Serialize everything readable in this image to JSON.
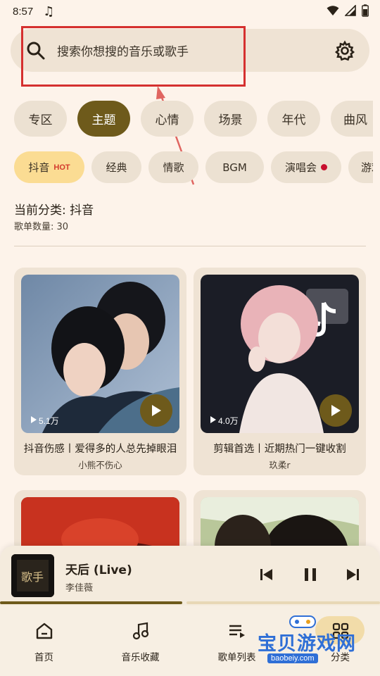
{
  "status_bar": {
    "time": "8:57"
  },
  "search": {
    "placeholder": "搜索你想搜的音乐或歌手"
  },
  "tabs_primary": [
    {
      "label": "专区",
      "active": false
    },
    {
      "label": "主题",
      "active": true
    },
    {
      "label": "心情",
      "active": false
    },
    {
      "label": "场景",
      "active": false
    },
    {
      "label": "年代",
      "active": false
    },
    {
      "label": "曲风",
      "active": false
    }
  ],
  "tabs_secondary": [
    {
      "label": "抖音",
      "badge": "HOT",
      "active": true
    },
    {
      "label": "经典",
      "active": false
    },
    {
      "label": "情歌",
      "active": false
    },
    {
      "label": "BGM",
      "active": false
    },
    {
      "label": "演唱会",
      "dot": true,
      "active": false
    },
    {
      "label": "游戏",
      "active": false
    }
  ],
  "category": {
    "current_label": "当前分类: 抖音",
    "count_label": "歌单数量: 30"
  },
  "playlists": [
    {
      "plays": "5.1万",
      "title": "抖音伤感丨爱得多的人总先掉眼泪",
      "author": "小熊不伤心"
    },
    {
      "plays": "4.0万",
      "title": "剪辑首选丨近期热门一键收割",
      "author": "玖柔r"
    },
    {
      "plays": "",
      "title": "",
      "author": ""
    },
    {
      "plays": "",
      "title": "",
      "author": ""
    }
  ],
  "player": {
    "song": "天后 (Live)",
    "artist": "李佳薇",
    "art_text": "歌手",
    "progress": 0.48
  },
  "bottom_nav": [
    {
      "label": "首页",
      "icon": "home-icon"
    },
    {
      "label": "音乐收藏",
      "icon": "music-note-icon"
    },
    {
      "label": "歌单列表",
      "icon": "playlist-icon"
    },
    {
      "label": "分类",
      "icon": "category-icon"
    }
  ],
  "watermark": {
    "text": "宝贝游戏网",
    "url": "baobeiy.com"
  },
  "colors": {
    "accent": "#6e5a1b",
    "background": "#fdf3ea",
    "chip": "#ece1d2",
    "active_chip_secondary": "#fbdc93",
    "annotation": "#d5302f"
  }
}
